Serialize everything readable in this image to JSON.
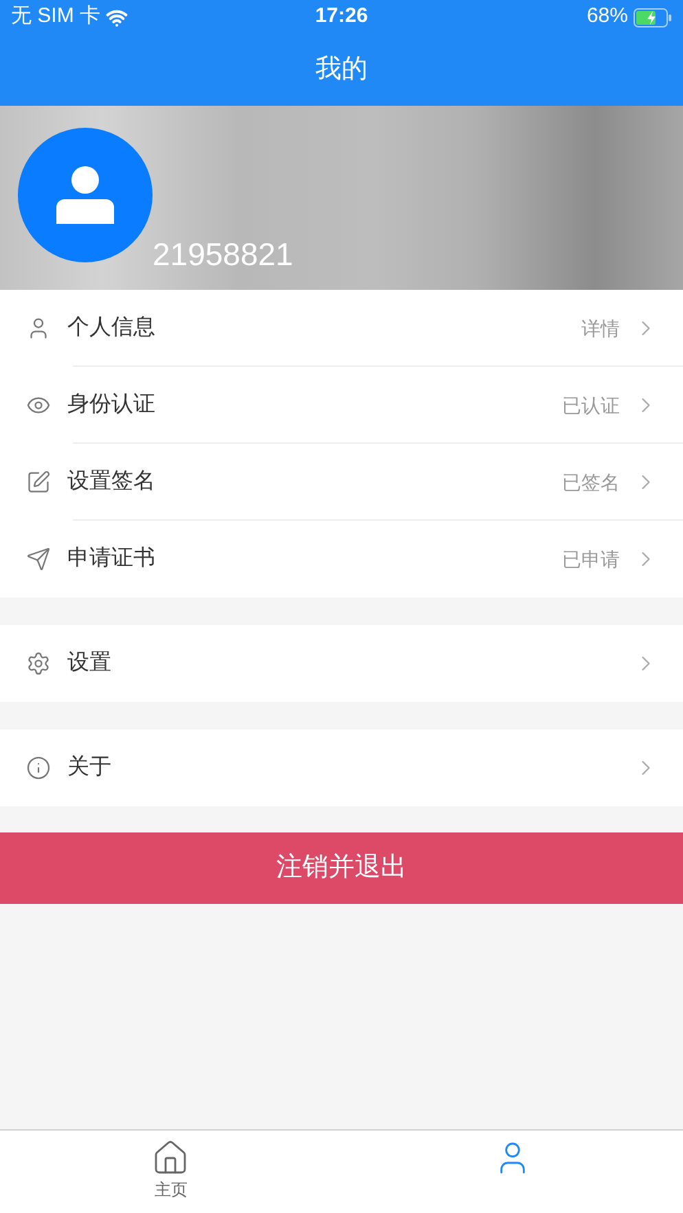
{
  "status_bar": {
    "carrier": "无 SIM 卡",
    "time": "17:26",
    "battery": "68%"
  },
  "nav": {
    "title": "我的"
  },
  "profile": {
    "user_id": "21958821"
  },
  "groups": [
    {
      "items": [
        {
          "label": "个人信息",
          "value": "详情"
        },
        {
          "label": "身份认证",
          "value": "已认证"
        },
        {
          "label": "设置签名",
          "value": "已签名"
        },
        {
          "label": "申请证书",
          "value": "已申请"
        }
      ]
    },
    {
      "items": [
        {
          "label": "设置"
        }
      ]
    },
    {
      "items": [
        {
          "label": "关于"
        }
      ]
    }
  ],
  "logout_button": "注销并退出",
  "tabs": [
    {
      "label": "主页",
      "selected": false
    },
    {
      "selected": true
    }
  ]
}
